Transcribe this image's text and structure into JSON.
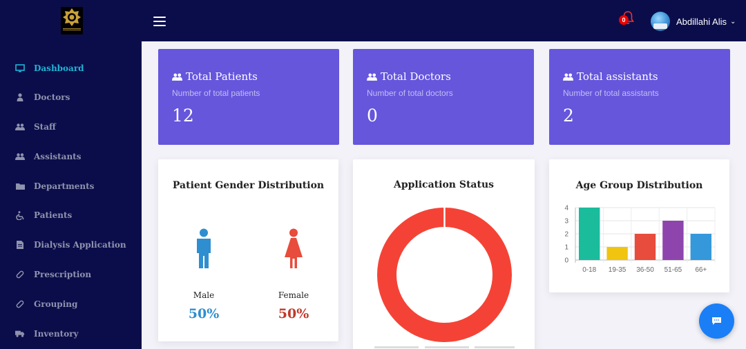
{
  "header": {
    "user_name": "Abdillahi Alis",
    "notification_count": "0"
  },
  "sidebar": {
    "items": [
      {
        "label": "Dashboard",
        "icon": "desktop-icon",
        "active": true
      },
      {
        "label": "Doctors",
        "icon": "user-doctor-icon"
      },
      {
        "label": "Staff",
        "icon": "users-icon"
      },
      {
        "label": "Assistants",
        "icon": "users-icon"
      },
      {
        "label": "Departments",
        "icon": "folder-icon"
      },
      {
        "label": "Patients",
        "icon": "wheelchair-icon"
      },
      {
        "label": "Dialysis Application",
        "icon": "file-icon"
      },
      {
        "label": "Prescription",
        "icon": "pill-icon"
      },
      {
        "label": "Grouping",
        "icon": "pill-icon"
      },
      {
        "label": "Inventory",
        "icon": "truck-icon"
      }
    ]
  },
  "stats": [
    {
      "title": "Total Patients",
      "subtitle": "Number of total patients",
      "value": "12"
    },
    {
      "title": "Total Doctors",
      "subtitle": "Number of total doctors",
      "value": "0"
    },
    {
      "title": "Total assistants",
      "subtitle": "Number of total assistants",
      "value": "2"
    }
  ],
  "gender": {
    "title": "Patient Gender Distribution",
    "male_label": "Male",
    "male_pct": "50%",
    "female_label": "Female",
    "female_pct": "50%",
    "male_color": "#2e8ecf",
    "female_color": "#e74c3c"
  },
  "status": {
    "title": "Application Status"
  },
  "colors": {
    "topbar": "#0b0d4a",
    "stat_card": "#6556dc",
    "active_nav": "#1fb5d6",
    "donut": "#f44336",
    "chat_button": "#1a7ef7"
  },
  "chart_data": [
    {
      "type": "pie",
      "title": "Application Status",
      "values": [
        1
      ],
      "colors": [
        "#f44336"
      ],
      "donut": true
    },
    {
      "type": "bar",
      "title": "Age Group Distribution",
      "categories": [
        "0-18",
        "19-35",
        "36-50",
        "51-65",
        "66+"
      ],
      "values": [
        4,
        1,
        2,
        3,
        2
      ],
      "colors": [
        "#1abc9c",
        "#f1c40f",
        "#e74c3c",
        "#8e44ad",
        "#3498db"
      ],
      "yticks": [
        "0",
        "1",
        "2",
        "3",
        "4"
      ],
      "ylim": [
        0,
        4
      ],
      "grid": true
    }
  ]
}
